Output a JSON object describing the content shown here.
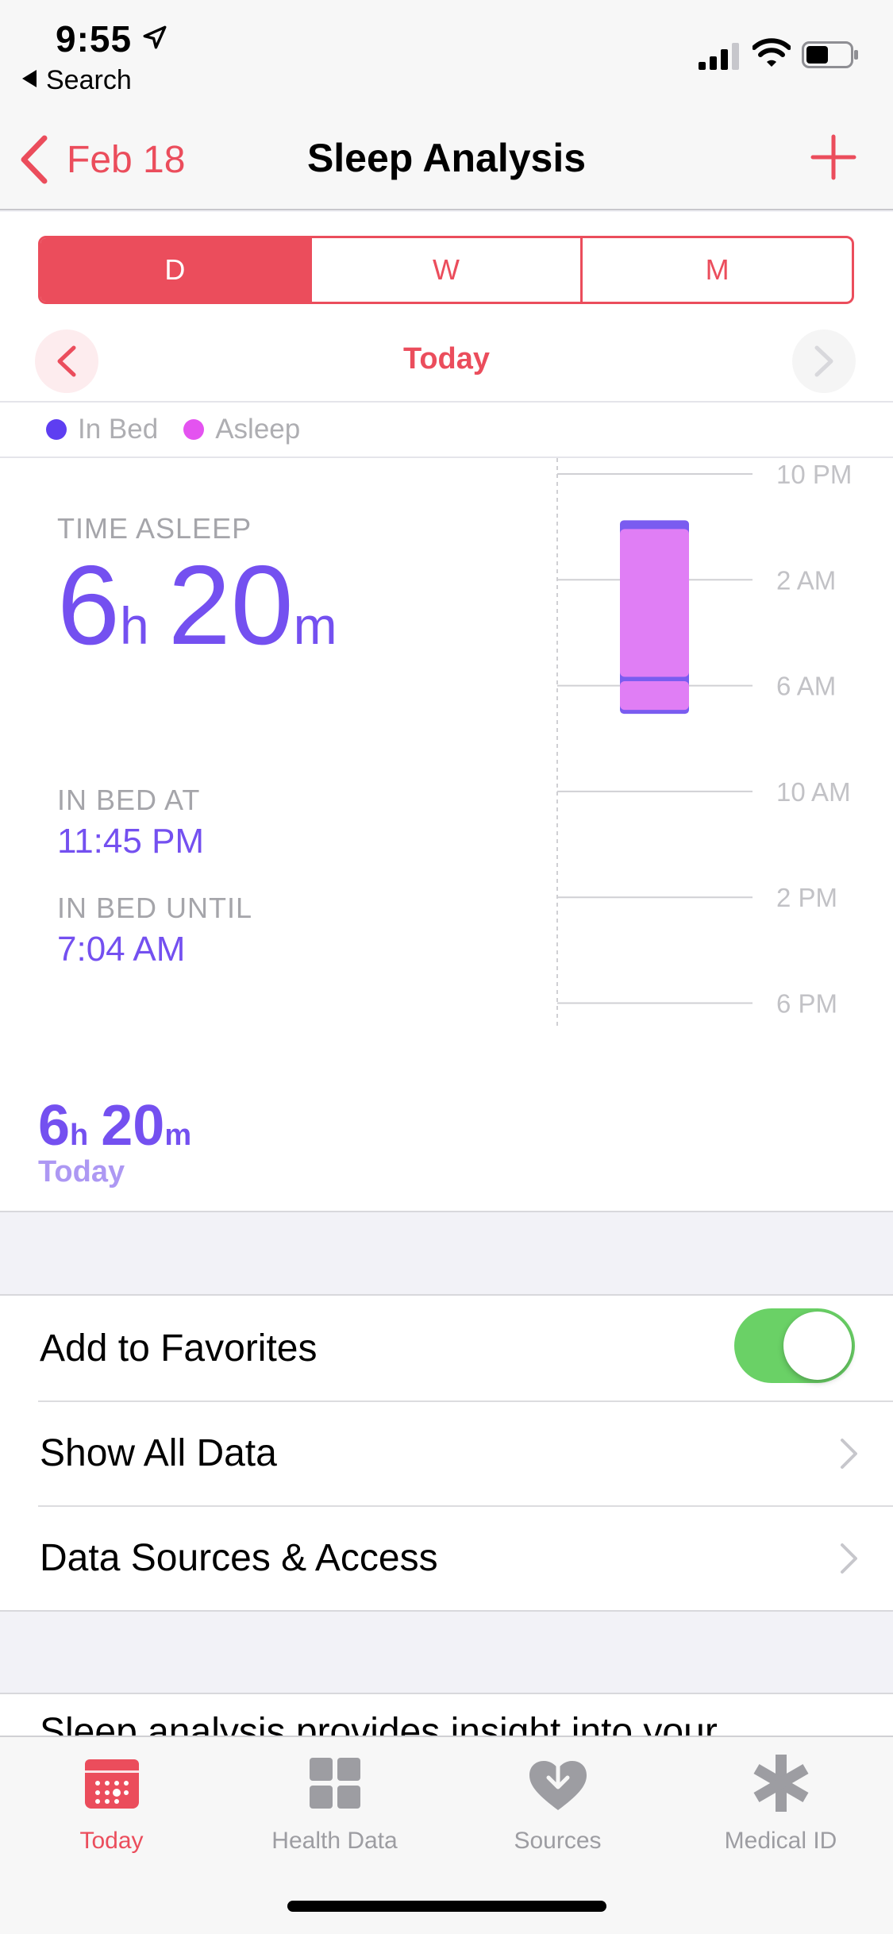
{
  "status": {
    "time": "9:55",
    "back_app": "Search"
  },
  "nav": {
    "back_label": "Feb 18",
    "title": "Sleep Analysis"
  },
  "segments": [
    "D",
    "W",
    "M"
  ],
  "selected_segment": "D",
  "period": "Today",
  "legend": [
    {
      "label": "In Bed",
      "color": "#5e3ef1"
    },
    {
      "label": "Asleep",
      "color": "#e453f0"
    }
  ],
  "stats": {
    "time_asleep_label": "TIME ASLEEP",
    "hours": "6",
    "hours_unit": "h",
    "minutes": "20",
    "minutes_unit": "m",
    "in_bed_at_label": "IN BED AT",
    "in_bed_at": "11:45 PM",
    "in_bed_until_label": "IN BED UNTIL",
    "in_bed_until": "7:04 AM"
  },
  "chart_data": {
    "type": "bar",
    "orientation": "vertical-time",
    "y_tick_labels": [
      "10 PM",
      "2 AM",
      "6 AM",
      "10 AM",
      "2 PM",
      "6 PM"
    ],
    "y_range_hours_from_10pm": [
      0,
      20
    ],
    "series": [
      {
        "name": "In Bed",
        "start": "11:45 PM",
        "end": "7:04 AM"
      },
      {
        "name": "Asleep",
        "segments": [
          [
            "12:05 AM",
            "5:40 AM"
          ],
          [
            "5:50 AM",
            "6:55 AM"
          ]
        ]
      }
    ]
  },
  "summary": {
    "hours": "6",
    "hours_unit": "h",
    "minutes": "20",
    "minutes_unit": "m",
    "label": "Today"
  },
  "settings": {
    "favorites_label": "Add to Favorites",
    "favorites_on": true,
    "show_all_label": "Show All Data",
    "sources_label": "Data Sources & Access"
  },
  "description": "Sleep analysis provides insight into your",
  "tabs": [
    {
      "label": "Today",
      "icon": "calendar-icon",
      "active": true
    },
    {
      "label": "Health Data",
      "icon": "grid-icon",
      "active": false
    },
    {
      "label": "Sources",
      "icon": "heart-download-icon",
      "active": false
    },
    {
      "label": "Medical ID",
      "icon": "asterisk-icon",
      "active": false
    }
  ],
  "colors": {
    "accent": "#eb4d5c",
    "purple": "#7450f0",
    "toggle_on": "#6ad166"
  }
}
